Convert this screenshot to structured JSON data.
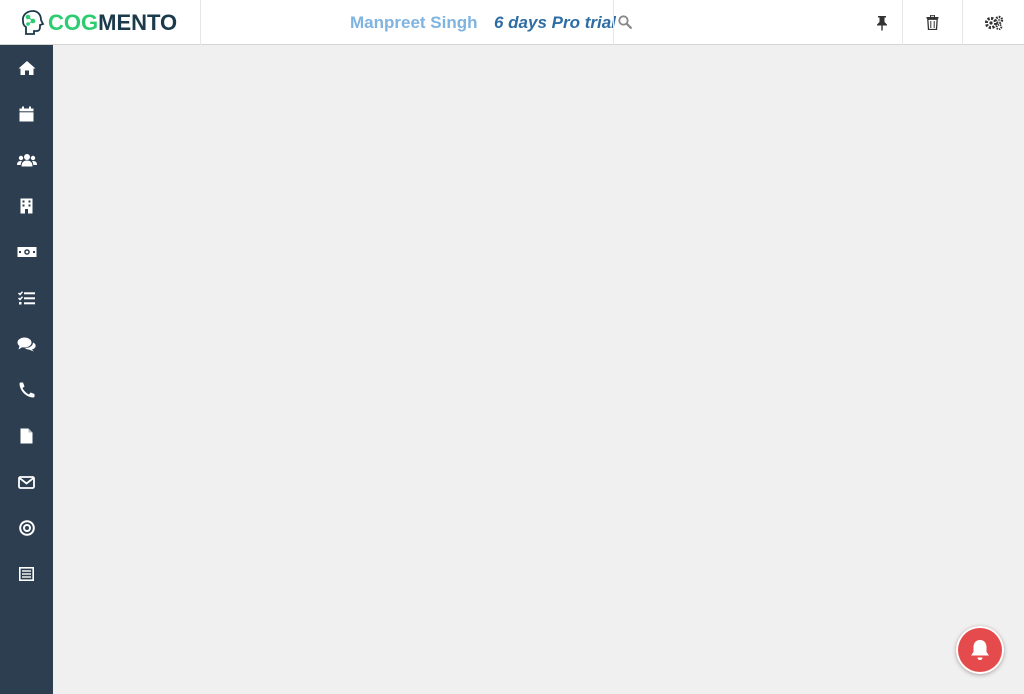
{
  "header": {
    "logo_prefix": "COG",
    "logo_suffix": "MENTO",
    "user_name": "Manpreet Singh",
    "trial_text": "6 days Pro trial"
  },
  "icons": {
    "search": "search-icon",
    "pin": "pin-icon",
    "trash": "trash-icon",
    "settings": "settings-icon",
    "notification": "bell-icon"
  },
  "sidebar": {
    "items": [
      {
        "name": "home",
        "icon": "home-icon"
      },
      {
        "name": "calendar",
        "icon": "calendar-icon"
      },
      {
        "name": "contacts",
        "icon": "users-icon"
      },
      {
        "name": "companies",
        "icon": "building-icon"
      },
      {
        "name": "deals",
        "icon": "money-icon"
      },
      {
        "name": "tasks",
        "icon": "tasks-icon"
      },
      {
        "name": "cases",
        "icon": "comments-icon"
      },
      {
        "name": "calls",
        "icon": "phone-icon"
      },
      {
        "name": "documents",
        "icon": "file-icon"
      },
      {
        "name": "email",
        "icon": "envelope-icon"
      },
      {
        "name": "campaigns",
        "icon": "target-icon"
      },
      {
        "name": "forms",
        "icon": "form-icon"
      }
    ]
  },
  "colors": {
    "sidebar_bg": "#2c3e50",
    "logo_green": "#2ecc71",
    "logo_dark": "#1b3a4b",
    "user_name": "#7fb3e0",
    "trial": "#2e6da4",
    "notification": "#e54b4d"
  }
}
